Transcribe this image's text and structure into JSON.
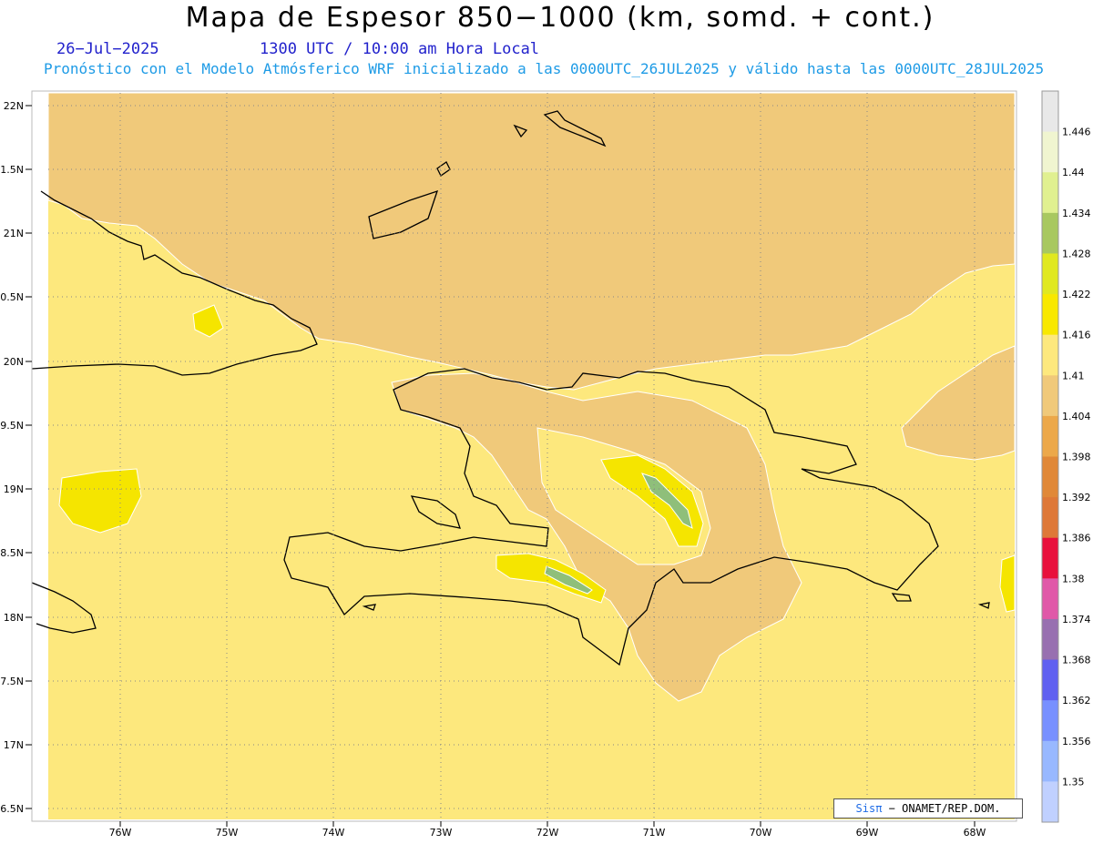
{
  "header": {
    "title": "Mapa de Espesor 850−1000 (km, somd. + cont.)",
    "date": "26−Jul−2025",
    "time": "1300 UTC / 10:00 am Hora Local",
    "forecast": "Pronóstico con el Modelo Atmósferico WRF inicializado a las 0000UTC_26JUL2025 y válido hasta las  0000UTC_28JUL2025"
  },
  "map": {
    "lat_labels": [
      "22N",
      "1.5N",
      "21N",
      "0.5N",
      "20N",
      "9.5N",
      "19N",
      "8.5N",
      "18N",
      "7.5N",
      "17N",
      "6.5N"
    ],
    "lon_labels": [
      "76W",
      "75W",
      "74W",
      "73W",
      "72W",
      "71W",
      "70W",
      "69W",
      "68W"
    ],
    "fill_colors": {
      "low": "#f0c97a",
      "mid": "#fde87d",
      "high": "#f5e500",
      "peak": "#8fbf7a"
    }
  },
  "colorbar": {
    "levels": [
      "1.446",
      "1.44",
      "1.434",
      "1.428",
      "1.422",
      "1.416",
      "1.41",
      "1.404",
      "1.398",
      "1.392",
      "1.386",
      "1.38",
      "1.374",
      "1.368",
      "1.362",
      "1.356",
      "1.35"
    ],
    "colors": [
      "#e8e8e8",
      "#f0f5d0",
      "#e0f090",
      "#a8c860",
      "#e0e820",
      "#f8e800",
      "#fde87d",
      "#f0c97a",
      "#eca84a",
      "#e08838",
      "#de7838",
      "#e8103c",
      "#e058a8",
      "#9870b0",
      "#6060f0",
      "#7890ff",
      "#98b8ff",
      "#c0d0ff"
    ]
  },
  "credit": {
    "brand": "Sisπ",
    "text": "− ONAMET/REP.DOM."
  }
}
